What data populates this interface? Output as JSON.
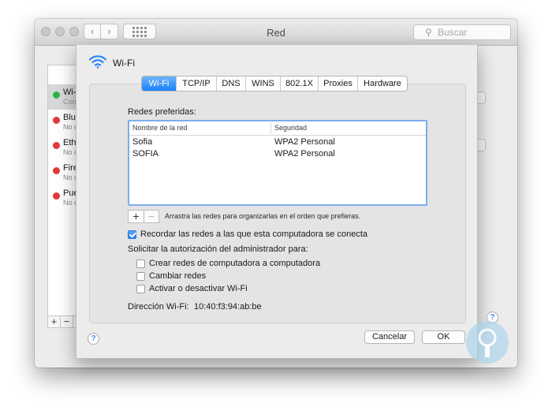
{
  "window": {
    "title": "Red",
    "search_placeholder": "Buscar",
    "nav_back": "‹",
    "nav_forward": "›"
  },
  "services": [
    {
      "name": "Wi-Fi",
      "status": "Conectado",
      "color": "#2fb449",
      "selected": true
    },
    {
      "name": "Bluetooth PAN",
      "status": "No conectado",
      "color": "#e23a3a"
    },
    {
      "name": "Ethernet",
      "status": "No conectado",
      "color": "#e23a3a"
    },
    {
      "name": "FireWire",
      "status": "No conectado",
      "color": "#e23a3a"
    },
    {
      "name": "Puente",
      "status": "No conectado",
      "color": "#e23a3a"
    }
  ],
  "service_footer": {
    "add": "+",
    "remove": "−"
  },
  "sheet": {
    "title": "Wi-Fi",
    "tabs": [
      "Wi-Fi",
      "TCP/IP",
      "DNS",
      "WINS",
      "802.1X",
      "Proxies",
      "Hardware"
    ],
    "active_tab": "Wi-Fi",
    "preferred_label": "Redes preferidas:",
    "table": {
      "columns": [
        "Nombre de la red",
        "Seguridad"
      ],
      "rows": [
        [
          "Sofia",
          "WPA2 Personal"
        ],
        [
          "SOFIA",
          "WPA2 Personal"
        ]
      ]
    },
    "add": "+",
    "remove": "−",
    "drag_hint": "Arrastra las redes para organizarlas en el orden que prefieras.",
    "remember": {
      "label": "Recordar las redes a las que esta computadora se conecta",
      "checked": true
    },
    "admin_label": "Solicitar la autorización del administrador para:",
    "admin_options": [
      {
        "label": "Crear redes de computadora a computadora",
        "checked": false
      },
      {
        "label": "Cambiar redes",
        "checked": false
      },
      {
        "label": "Activar o desactivar Wi-Fi",
        "checked": false
      }
    ],
    "address_label": "Dirección Wi-Fi:",
    "address_value": "10:40:f3:94:ab:be",
    "help": "?",
    "cancel": "Cancelar",
    "ok": "OK"
  },
  "colors": {
    "accent": "#1a82f9",
    "table_focus": "#7cadea",
    "watermark": "#a9d3ec"
  }
}
